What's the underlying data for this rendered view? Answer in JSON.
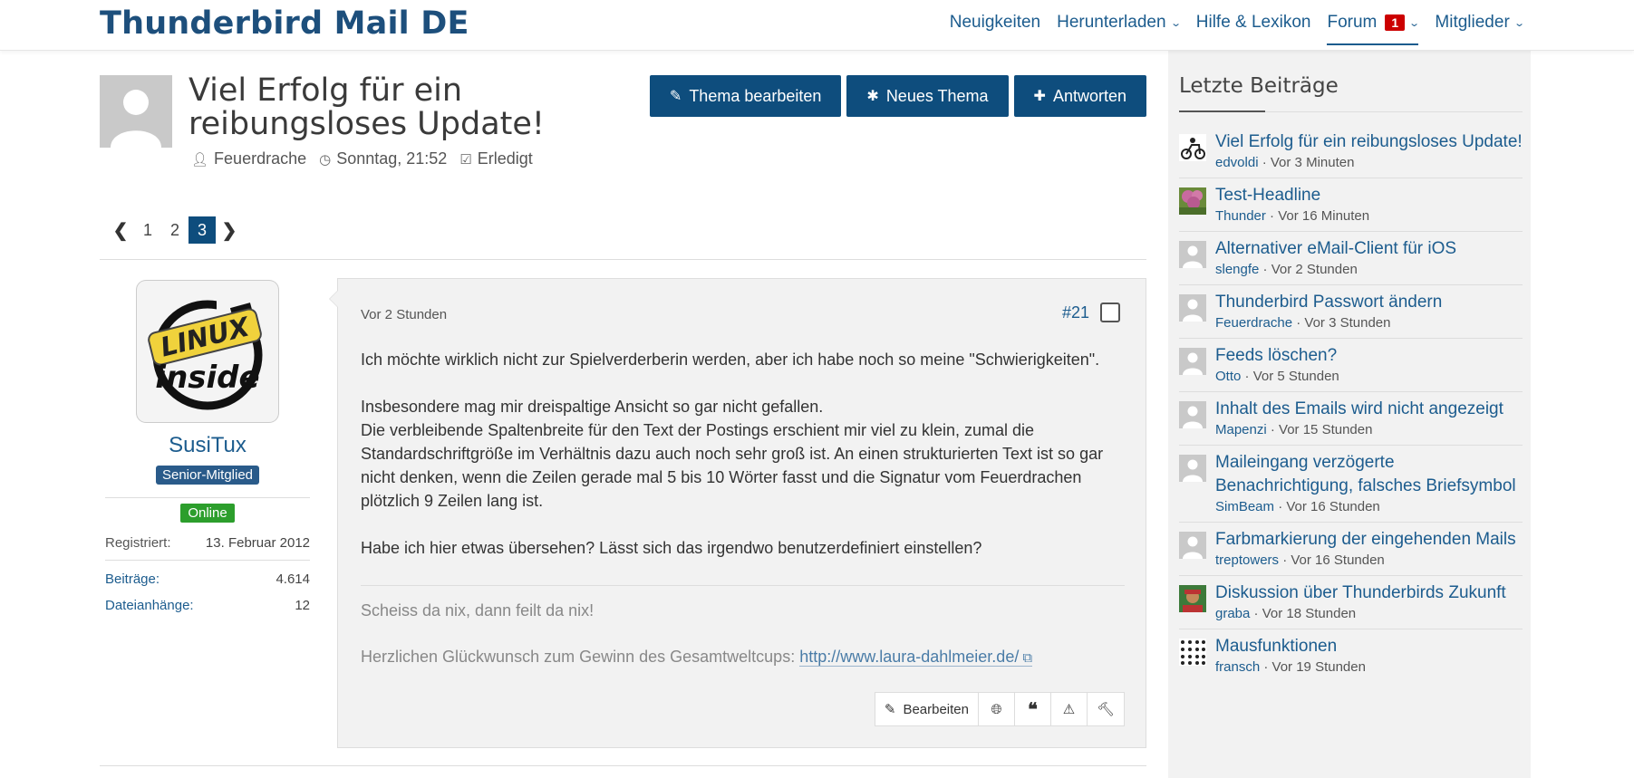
{
  "site": {
    "title": "Thunderbird Mail DE"
  },
  "nav": {
    "items": [
      {
        "label": "Neuigkeiten"
      },
      {
        "label": "Herunterladen"
      },
      {
        "label": "Hilfe & Lexikon"
      },
      {
        "label": "Forum",
        "badge": "1"
      },
      {
        "label": "Mitglieder"
      }
    ]
  },
  "thread": {
    "title": "Viel Erfolg für ein reibungsloses Update!",
    "author": "Feuerdrache",
    "date": "Sonntag, 21:52",
    "status": "Erledigt"
  },
  "buttons": {
    "edit_thread": "Thema bearbeiten",
    "new_thread": "Neues Thema",
    "reply": "Antworten"
  },
  "pagination": {
    "pages": [
      "1",
      "2",
      "3"
    ],
    "current": "3"
  },
  "post": {
    "author": {
      "name": "SusiTux",
      "avatar_text_top": "LINUX",
      "avatar_text_bottom": "inside",
      "rank": "Senior-Mitglied",
      "online": "Online",
      "registered_label": "Registriert:",
      "registered_value": "13. Februar 2012",
      "posts_label": "Beiträge:",
      "posts_value": "4.614",
      "attachments_label": "Dateianhänge:",
      "attachments_value": "12"
    },
    "time": "Vor 2 Stunden",
    "number": "#21",
    "paragraphs": [
      "Ich möchte wirklich nicht zur Spielverderberin werden, aber ich habe noch so meine \"Schwierigkeiten\".",
      "Insbesondere mag mir dreispaltige Ansicht so gar nicht gefallen.\nDie verbleibende Spaltenbreite für den Text der Postings erschient mir viel zu klein, zumal die Standardschriftgröße im Verhältnis dazu auch noch sehr groß ist. An einen strukturierten Text ist so gar nicht denken, wenn die Zeilen gerade mal 5 bis 10 Wörter fasst und die Signatur vom Feuerdrachen plötzlich 9 Zeilen lang ist.",
      "Habe ich hier etwas übersehen? Lässt sich das irgendwo benutzerdefiniert einstellen?"
    ],
    "signature": {
      "line1": "Scheiss da nix, dann feilt da nix!",
      "line2_prefix": "Herzlichen Glückwunsch zum Gewinn des Gesamtweltcups: ",
      "line2_link": "http://www.laura-dahlmeier.de/"
    },
    "actions": {
      "edit": "Bearbeiten"
    }
  },
  "sidebar": {
    "title": "Letzte Beiträge",
    "items": [
      {
        "title": "Viel Erfolg für ein reibungsloses Update!",
        "user": "edvoldi",
        "time": " · Vor 3 Minuten",
        "avatar": "scooter"
      },
      {
        "title": "Test-Headline",
        "user": "Thunder",
        "time": " · Vor 16 Minuten",
        "avatar": "flower"
      },
      {
        "title": "Alternativer eMail-Client für iOS",
        "user": "slengfe",
        "time": " · Vor 2 Stunden",
        "avatar": "default"
      },
      {
        "title": "Thunderbird Passwort ändern",
        "user": "Feuerdrache",
        "time": " · Vor 3 Stunden",
        "avatar": "default"
      },
      {
        "title": "Feeds löschen?",
        "user": "Otto",
        "time": " · Vor 5 Stunden",
        "avatar": "default"
      },
      {
        "title": "Inhalt des Emails wird nicht angezeigt",
        "user": "Mapenzi",
        "time": " · Vor 15 Stunden",
        "avatar": "default"
      },
      {
        "title": "Maileingang verzögerte Benachrichtigung, falsches Briefsymbol",
        "user": "SimBeam",
        "time": " · Vor 16 Stunden",
        "avatar": "default"
      },
      {
        "title": "Farbmarkierung der eingehenden Mails",
        "user": "treptowers",
        "time": " · Vor 16 Stunden",
        "avatar": "default"
      },
      {
        "title": "Diskussion über Thunderbirds Zukunft",
        "user": "graba",
        "time": " · Vor 18 Stunden",
        "avatar": "person"
      },
      {
        "title": "Mausfunktionen",
        "user": "fransch",
        "time": " · Vor 19 Stunden",
        "avatar": "dots"
      }
    ]
  },
  "colors": {
    "brand": "#1d4f7c",
    "button": "#0e4d7d",
    "link": "#1c5c8e",
    "online": "#2c9e2c",
    "badge": "#cc0000"
  }
}
